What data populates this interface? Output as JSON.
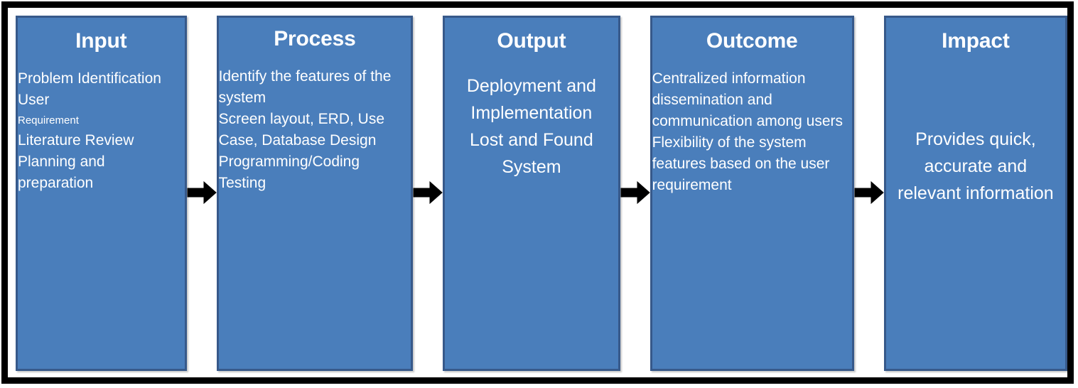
{
  "diagram": {
    "title": "Input-Process-Output-Outcome-Impact Framework",
    "colors": {
      "box_fill": "#4a7ebb",
      "box_border": "#37598a",
      "frame": "#000000",
      "text": "#ffffff",
      "arrow": "#000000"
    },
    "arrow_icon": "right-arrow-icon"
  },
  "stages": [
    {
      "id": "input",
      "title": "Input",
      "items": [
        {
          "text": "Problem Identification"
        },
        {
          "text": "User",
          "sub": "Requirement"
        },
        {
          "text": "Literature Review"
        },
        {
          "text": "Planning and preparation"
        }
      ]
    },
    {
      "id": "process",
      "title": "Process",
      "items": [
        {
          "text": "Identify the features of the system"
        },
        {
          "text": "Screen layout, ERD, Use Case, Database Design"
        },
        {
          "text": "Programming/Coding"
        },
        {
          "text": "Testing"
        }
      ]
    },
    {
      "id": "output",
      "title": "Output",
      "body": "Deployment and Implementation Lost and Found System"
    },
    {
      "id": "outcome",
      "title": "Outcome",
      "items": [
        {
          "text": "Centralized information dissemination and communication among users"
        },
        {
          "text": "Flexibility of the system features based on the user requirement"
        }
      ]
    },
    {
      "id": "impact",
      "title": "Impact",
      "body": "Provides quick, accurate and relevant information"
    }
  ],
  "arrows": [
    {
      "from": "input",
      "to": "process"
    },
    {
      "from": "process",
      "to": "output"
    },
    {
      "from": "output",
      "to": "outcome"
    },
    {
      "from": "outcome",
      "to": "impact"
    }
  ]
}
